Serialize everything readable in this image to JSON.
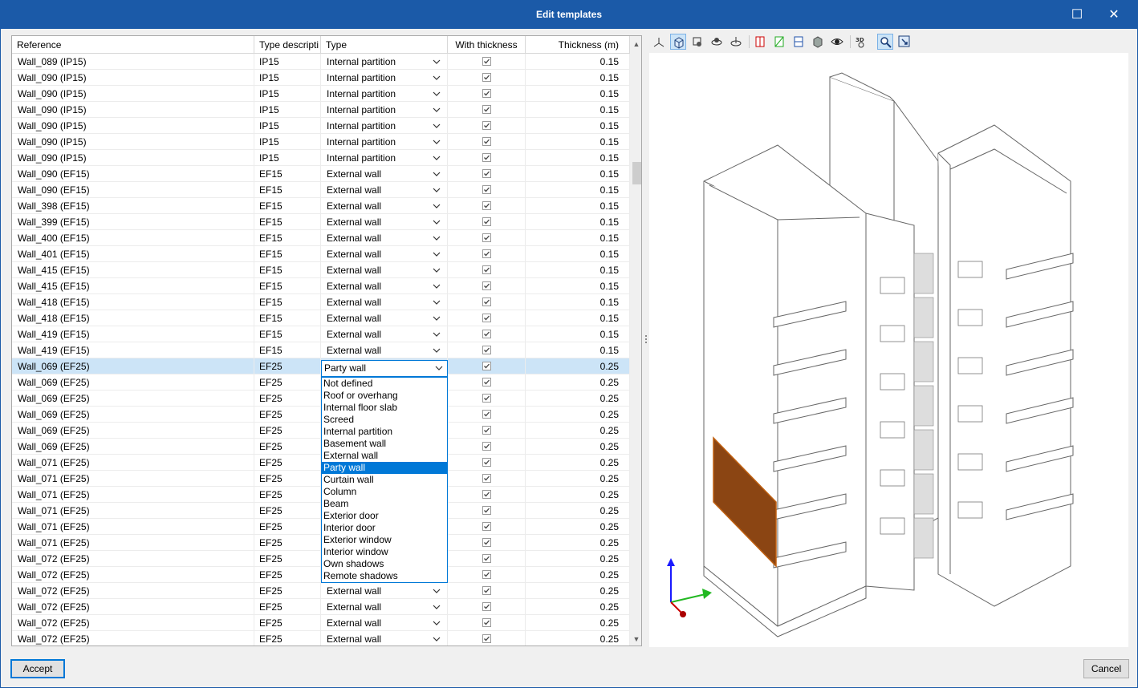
{
  "window": {
    "title": "Edit templates",
    "minimize_icon": "minimize-icon",
    "close_icon": "close-icon"
  },
  "table": {
    "columns": [
      "Reference",
      "Type descripti",
      "Type",
      "With thickness",
      "Thickness (m)"
    ],
    "rows": [
      {
        "ref": "Wall_089 (IP15)",
        "desc": "IP15",
        "type": "Internal partition",
        "with": true,
        "thk": "0.15"
      },
      {
        "ref": "Wall_090 (IP15)",
        "desc": "IP15",
        "type": "Internal partition",
        "with": true,
        "thk": "0.15"
      },
      {
        "ref": "Wall_090 (IP15)",
        "desc": "IP15",
        "type": "Internal partition",
        "with": true,
        "thk": "0.15"
      },
      {
        "ref": "Wall_090 (IP15)",
        "desc": "IP15",
        "type": "Internal partition",
        "with": true,
        "thk": "0.15"
      },
      {
        "ref": "Wall_090 (IP15)",
        "desc": "IP15",
        "type": "Internal partition",
        "with": true,
        "thk": "0.15"
      },
      {
        "ref": "Wall_090 (IP15)",
        "desc": "IP15",
        "type": "Internal partition",
        "with": true,
        "thk": "0.15"
      },
      {
        "ref": "Wall_090 (IP15)",
        "desc": "IP15",
        "type": "Internal partition",
        "with": true,
        "thk": "0.15"
      },
      {
        "ref": "Wall_090 (EF15)",
        "desc": "EF15",
        "type": "External wall",
        "with": true,
        "thk": "0.15"
      },
      {
        "ref": "Wall_090 (EF15)",
        "desc": "EF15",
        "type": "External wall",
        "with": true,
        "thk": "0.15"
      },
      {
        "ref": "Wall_398 (EF15)",
        "desc": "EF15",
        "type": "External wall",
        "with": true,
        "thk": "0.15"
      },
      {
        "ref": "Wall_399 (EF15)",
        "desc": "EF15",
        "type": "External wall",
        "with": true,
        "thk": "0.15"
      },
      {
        "ref": "Wall_400 (EF15)",
        "desc": "EF15",
        "type": "External wall",
        "with": true,
        "thk": "0.15"
      },
      {
        "ref": "Wall_401 (EF15)",
        "desc": "EF15",
        "type": "External wall",
        "with": true,
        "thk": "0.15"
      },
      {
        "ref": "Wall_415 (EF15)",
        "desc": "EF15",
        "type": "External wall",
        "with": true,
        "thk": "0.15"
      },
      {
        "ref": "Wall_415 (EF15)",
        "desc": "EF15",
        "type": "External wall",
        "with": true,
        "thk": "0.15"
      },
      {
        "ref": "Wall_418 (EF15)",
        "desc": "EF15",
        "type": "External wall",
        "with": true,
        "thk": "0.15"
      },
      {
        "ref": "Wall_418 (EF15)",
        "desc": "EF15",
        "type": "External wall",
        "with": true,
        "thk": "0.15"
      },
      {
        "ref": "Wall_419 (EF15)",
        "desc": "EF15",
        "type": "External wall",
        "with": true,
        "thk": "0.15"
      },
      {
        "ref": "Wall_419 (EF15)",
        "desc": "EF15",
        "type": "External wall",
        "with": true,
        "thk": "0.15"
      },
      {
        "ref": "Wall_069 (EF25)",
        "desc": "EF25",
        "type": "Party wall",
        "with": true,
        "thk": "0.25",
        "selected": true
      },
      {
        "ref": "Wall_069 (EF25)",
        "desc": "EF25",
        "type": "",
        "with": true,
        "thk": "0.25"
      },
      {
        "ref": "Wall_069 (EF25)",
        "desc": "EF25",
        "type": "",
        "with": true,
        "thk": "0.25"
      },
      {
        "ref": "Wall_069 (EF25)",
        "desc": "EF25",
        "type": "",
        "with": true,
        "thk": "0.25"
      },
      {
        "ref": "Wall_069 (EF25)",
        "desc": "EF25",
        "type": "",
        "with": true,
        "thk": "0.25"
      },
      {
        "ref": "Wall_069 (EF25)",
        "desc": "EF25",
        "type": "",
        "with": true,
        "thk": "0.25"
      },
      {
        "ref": "Wall_071 (EF25)",
        "desc": "EF25",
        "type": "",
        "with": true,
        "thk": "0.25"
      },
      {
        "ref": "Wall_071 (EF25)",
        "desc": "EF25",
        "type": "",
        "with": true,
        "thk": "0.25"
      },
      {
        "ref": "Wall_071 (EF25)",
        "desc": "EF25",
        "type": "",
        "with": true,
        "thk": "0.25"
      },
      {
        "ref": "Wall_071 (EF25)",
        "desc": "EF25",
        "type": "",
        "with": true,
        "thk": "0.25"
      },
      {
        "ref": "Wall_071 (EF25)",
        "desc": "EF25",
        "type": "",
        "with": true,
        "thk": "0.25"
      },
      {
        "ref": "Wall_071 (EF25)",
        "desc": "EF25",
        "type": "",
        "with": true,
        "thk": "0.25"
      },
      {
        "ref": "Wall_072 (EF25)",
        "desc": "EF25",
        "type": "",
        "with": true,
        "thk": "0.25"
      },
      {
        "ref": "Wall_072 (EF25)",
        "desc": "EF25",
        "type": "",
        "with": true,
        "thk": "0.25"
      },
      {
        "ref": "Wall_072 (EF25)",
        "desc": "EF25",
        "type": "External wall",
        "with": true,
        "thk": "0.25"
      },
      {
        "ref": "Wall_072 (EF25)",
        "desc": "EF25",
        "type": "External wall",
        "with": true,
        "thk": "0.25"
      },
      {
        "ref": "Wall_072 (EF25)",
        "desc": "EF25",
        "type": "External wall",
        "with": true,
        "thk": "0.25"
      },
      {
        "ref": "Wall_072 (EF25)",
        "desc": "EF25",
        "type": "External wall",
        "with": true,
        "thk": "0.25"
      }
    ]
  },
  "dropdown": {
    "value": "Party wall",
    "options": [
      "Not defined",
      "Roof or overhang",
      "Internal floor slab",
      "Screed",
      "Internal partition",
      "Basement wall",
      "External wall",
      "Party wall",
      "Curtain wall",
      "Column",
      "Beam",
      "Exterior door",
      "Interior door",
      "Exterior window",
      "Interior window",
      "Own shadows",
      "Remote shadows"
    ],
    "selected_index": 7
  },
  "viewer": {
    "tools": [
      "axes-icon",
      "cube-view-icon",
      "orbit-icon",
      "pan-3d-icon",
      "rotate-icon",
      "red-face-icon",
      "green-face-icon",
      "blue-face-icon",
      "solid-icon",
      "eye-icon",
      "3d-icon",
      "zoom-icon",
      "zoom-window-icon"
    ],
    "highlight_color": "#8b4513"
  },
  "footer": {
    "accept": "Accept",
    "cancel": "Cancel"
  }
}
